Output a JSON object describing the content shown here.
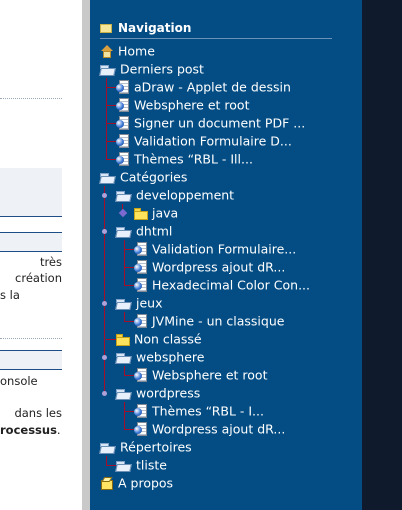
{
  "left": {
    "fragments": [
      {
        "text": "très"
      },
      {
        "text": "création"
      },
      {
        "text": "s la"
      },
      {
        "text": "onsole"
      },
      {
        "text": "dans les"
      },
      {
        "prefix": "",
        "bold": "rocessus",
        "suffix": "."
      }
    ]
  },
  "nav": {
    "title": "Navigation",
    "home": "Home",
    "derniers": {
      "label": "Derniers post",
      "items": [
        "aDraw - Applet de dessin",
        "Websphere et root",
        "Signer un document PDF ...",
        "Validation Formulaire D...",
        "Thèmes “RBL - Ill..."
      ]
    },
    "categories": {
      "label": "Catégories",
      "developpement": {
        "label": "developpement",
        "java": "java"
      },
      "dhtml": {
        "label": "dhtml",
        "items": [
          "Validation Formulaire...",
          "Wordpress ajout dR...",
          "Hexadecimal Color Con..."
        ]
      },
      "jeux": {
        "label": "jeux",
        "items": [
          "JVMine - un classique"
        ]
      },
      "non_classe": "Non classé",
      "websphere": {
        "label": "websphere",
        "items": [
          "Websphere et root"
        ]
      },
      "wordpress": {
        "label": "wordpress",
        "items": [
          "Thèmes “RBL - I...",
          "Wordpress ajout dR..."
        ]
      }
    },
    "repertoires": {
      "label": "Répertoires",
      "items": [
        "tliste"
      ]
    },
    "apropos": "A propos"
  },
  "colors": {
    "nav_bg": "#044d84",
    "tree_line": "#a40e2a",
    "text": "#ffffff"
  }
}
